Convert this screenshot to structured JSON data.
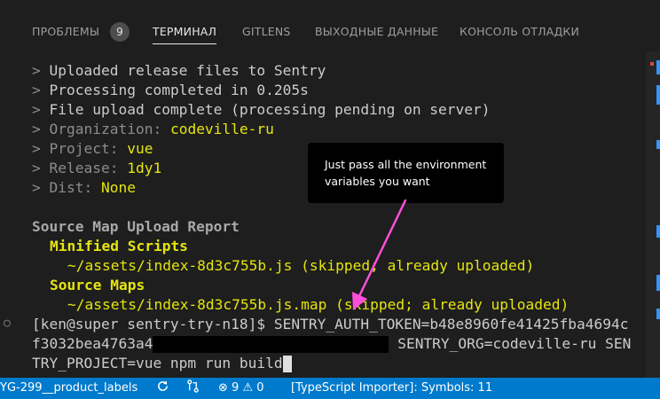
{
  "panel": {
    "tabs": [
      {
        "label": "ПРОБЛЕМЫ",
        "badge": "9"
      },
      {
        "label": "ТЕРМИНАЛ"
      },
      {
        "label": "GITLENS"
      },
      {
        "label": "ВЫХОДНЫЕ ДАННЫЕ"
      },
      {
        "label": "КОНСОЛЬ ОТЛАДКИ"
      }
    ],
    "active_tab": "ТЕРМИНАЛ"
  },
  "terminal": {
    "prompt_char": ">",
    "lines": [
      {
        "text": "Uploaded release files to Sentry"
      },
      {
        "text": "Processing completed in 0.205s"
      },
      {
        "text": "File upload complete (processing pending on server)"
      },
      {
        "key": "Organization:",
        "value": "codeville-ru"
      },
      {
        "key": "Project:",
        "value": "vue"
      },
      {
        "key": "Release:",
        "value": "1dy1"
      },
      {
        "key": "Dist:",
        "value": "None"
      }
    ],
    "report_title": "Source Map Upload Report",
    "minified_heading": "Minified Scripts",
    "minified_file": "~/assets/index-8d3c755b.js (skipped; already uploaded)",
    "maps_heading": "Source Maps",
    "maps_file": "~/assets/index-8d3c755b.js.map (skipped; already uploaded)",
    "command_prompt": "[ken@super sentry-try-n18]$ ",
    "command_part1": "SENTRY_AUTH_TOKEN=b48e8960fe41425fba4694c",
    "command_part2a": "f3032bea4763a4",
    "command_part2b": " SENTRY_ORG=codeville-ru SEN",
    "command_part3": "TRY_PROJECT=vue npm run build",
    "gutter_marker": "○"
  },
  "tooltip": {
    "text": "Just pass all the environment variables you want"
  },
  "statusbar": {
    "branch": "YG-299__product_labels",
    "sync_icon": "sync-icon",
    "remote_icon": "git-compare-icon",
    "errors": "9",
    "warnings": "0",
    "ts_importer": "[TypeScript Importer]: Symbols: 11"
  },
  "colors": {
    "accent": "#007acc",
    "highlight": "#e5e510",
    "arrow": "#ff4fd8"
  }
}
